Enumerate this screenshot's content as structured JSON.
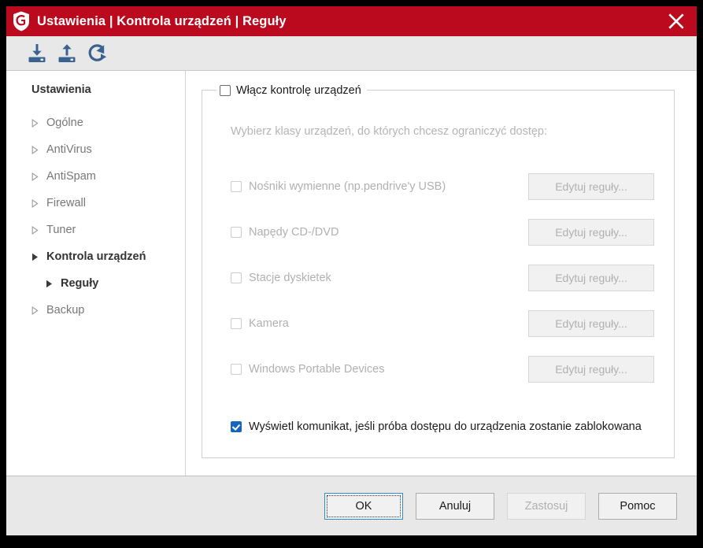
{
  "window": {
    "title": "Ustawienia | Kontrola urządzeń | Reguły",
    "close_label": "✕",
    "accent_color": "#bb0a1e",
    "toolbar_icon_color": "#3a628f"
  },
  "toolbar": {
    "items": [
      {
        "name": "import-settings-icon",
        "tooltip": "Import"
      },
      {
        "name": "export-settings-icon",
        "tooltip": "Export"
      },
      {
        "name": "reset-settings-icon",
        "tooltip": "Reset"
      }
    ]
  },
  "sidebar": {
    "heading": "Ustawienia",
    "items": [
      {
        "label": "Ogólne",
        "level": 1,
        "active": false
      },
      {
        "label": "AntiVirus",
        "level": 1,
        "active": false
      },
      {
        "label": "AntiSpam",
        "level": 1,
        "active": false
      },
      {
        "label": "Firewall",
        "level": 1,
        "active": false
      },
      {
        "label": "Tuner",
        "level": 1,
        "active": false
      },
      {
        "label": "Kontrola urządzeń",
        "level": 1,
        "active": true
      },
      {
        "label": "Reguły",
        "level": 2,
        "active": true
      },
      {
        "label": "Backup",
        "level": 1,
        "active": false
      }
    ]
  },
  "main": {
    "group_legend_label": "Włącz kontrolę urządzeń",
    "group_legend_checked": false,
    "description": "Wybierz klasy urządzeń, do których chcesz ograniczyć dostęp:",
    "edit_button_label": "Edytuj reguły...",
    "devices": [
      {
        "label": "Nośniki wymienne (np.pendrive'y USB)",
        "checked": false,
        "enabled": false
      },
      {
        "label": "Napędy CD-/DVD",
        "checked": false,
        "enabled": false
      },
      {
        "label": "Stacje dyskietek",
        "checked": false,
        "enabled": false
      },
      {
        "label": "Kamera",
        "checked": false,
        "enabled": false
      },
      {
        "label": "Windows Portable Devices",
        "checked": false,
        "enabled": false
      }
    ],
    "notify": {
      "label": "Wyświetl komunikat, jeśli próba dostępu do urządzenia zostanie zablokowana",
      "checked": true
    }
  },
  "footer": {
    "buttons": [
      {
        "label": "OK",
        "state": "focused"
      },
      {
        "label": "Anuluj",
        "state": "normal"
      },
      {
        "label": "Zastosuj",
        "state": "disabled"
      },
      {
        "label": "Pomoc",
        "state": "normal"
      }
    ]
  }
}
